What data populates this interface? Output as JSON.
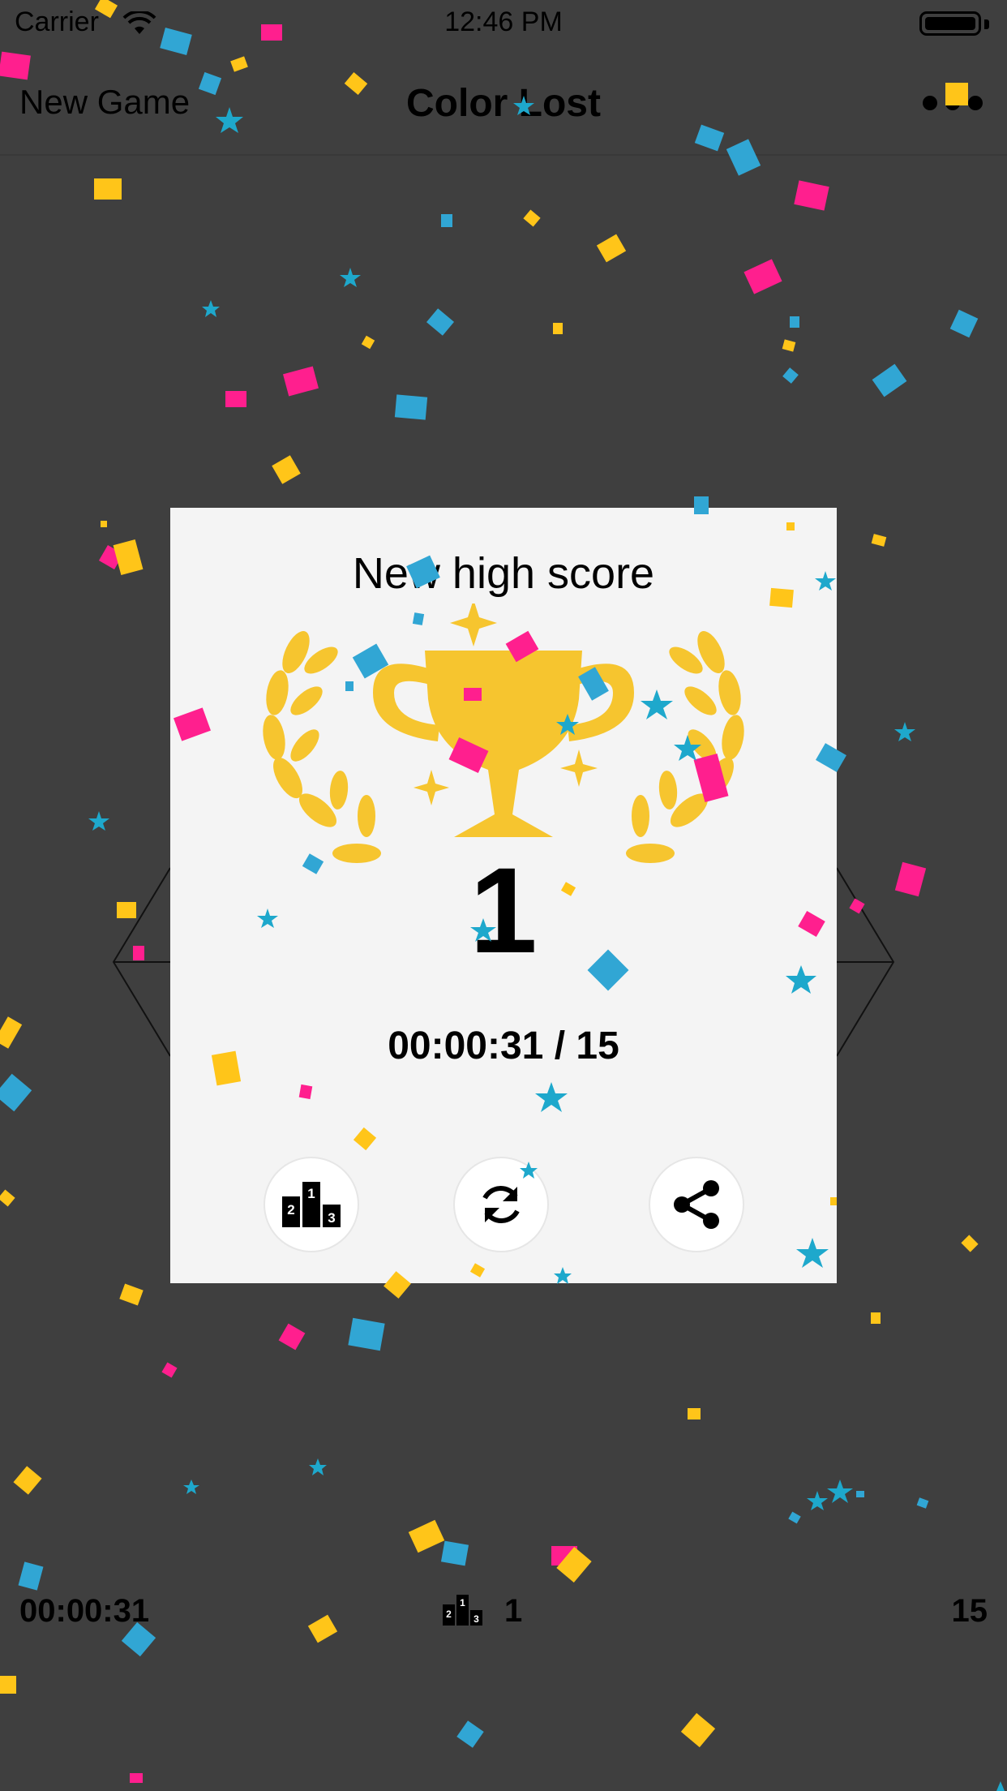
{
  "status_bar": {
    "carrier": "Carrier",
    "time": "12:46 PM"
  },
  "nav": {
    "new_game": "New Game",
    "title": "Color Lost",
    "more_icon": "more-dots-icon"
  },
  "dialog": {
    "title": "New high score",
    "trophy_icon": "trophy-laurel-icon",
    "score": "1",
    "time_moves": "00:00:31 / 15",
    "buttons": [
      {
        "name": "leaderboard-button",
        "icon": "podium-icon"
      },
      {
        "name": "restart-button",
        "icon": "refresh-icon"
      },
      {
        "name": "share-button",
        "icon": "share-icon"
      }
    ]
  },
  "footer": {
    "elapsed": "00:00:31",
    "rank": "1",
    "moves": "15"
  },
  "colors": {
    "background": "#3f3f3f",
    "card": "#f4f4f4",
    "gold": "#f6c52f",
    "pink": "#ff1f8e",
    "blue": "#31a6d4",
    "yellow": "#ffc519"
  }
}
